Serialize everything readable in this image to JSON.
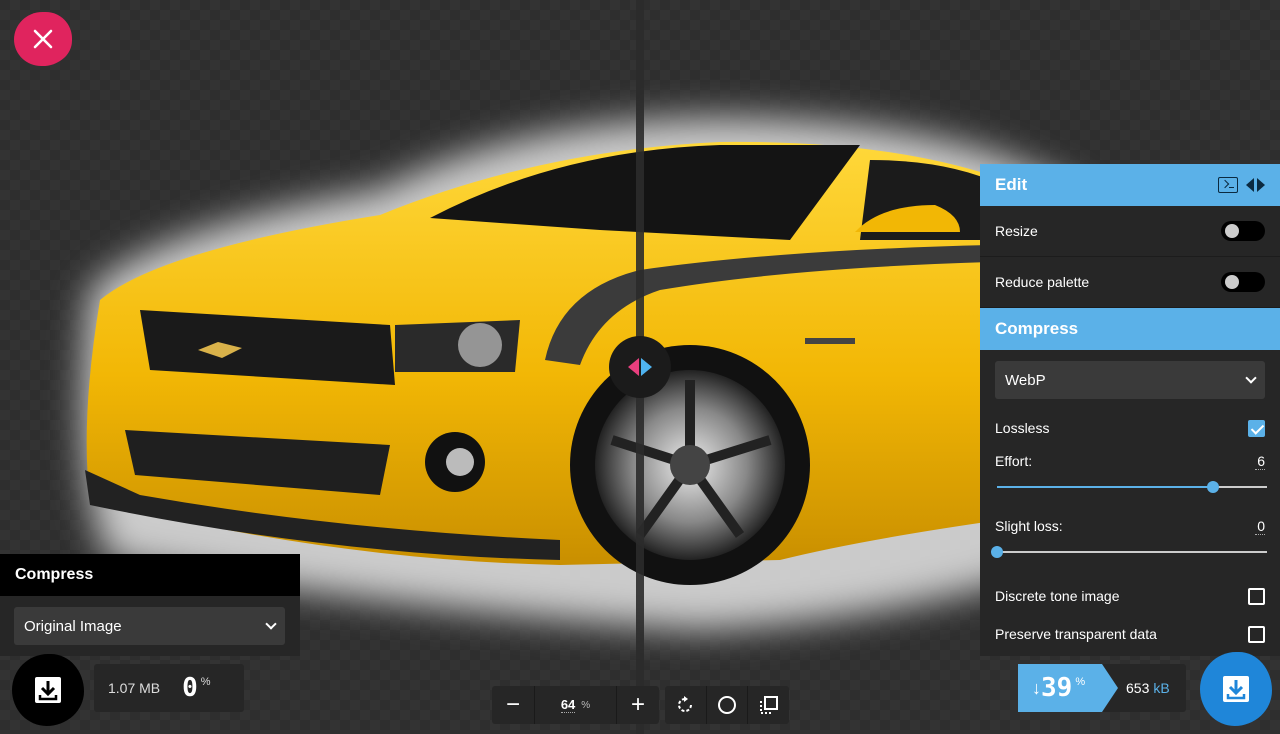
{
  "close_button": {
    "icon": "close-icon",
    "color": "#e0245e"
  },
  "left": {
    "title": "Compress",
    "method": "Original Image",
    "file_size": "1.07 MB",
    "percent": "0",
    "percent_symbol": "%"
  },
  "right": {
    "edit_title": "Edit",
    "resize_label": "Resize",
    "resize_on": false,
    "reduce_palette_label": "Reduce palette",
    "reduce_palette_on": false,
    "compress_title": "Compress",
    "method": "WebP",
    "lossless_label": "Lossless",
    "lossless_checked": true,
    "effort_label": "Effort:",
    "effort_value": "6",
    "effort_level": 0.8,
    "slight_loss_label": "Slight loss:",
    "slight_loss_value": "0",
    "slight_loss_level": 0,
    "discrete_tone_label": "Discrete tone image",
    "discrete_tone_checked": false,
    "preserve_transparent_label": "Preserve transparent data",
    "preserve_transparent_checked": false,
    "reduction_arrow": "↓",
    "reduction_percent": "39",
    "percent_symbol": "%",
    "size_value": "653",
    "size_unit": "kB"
  },
  "zoom": {
    "minus": "−",
    "value": "64",
    "unit": "%",
    "plus": "+"
  },
  "colors": {
    "accent": "#5bb1e8",
    "close": "#e0245e",
    "download_right": "#1f86d9",
    "car": "#f2b705"
  }
}
